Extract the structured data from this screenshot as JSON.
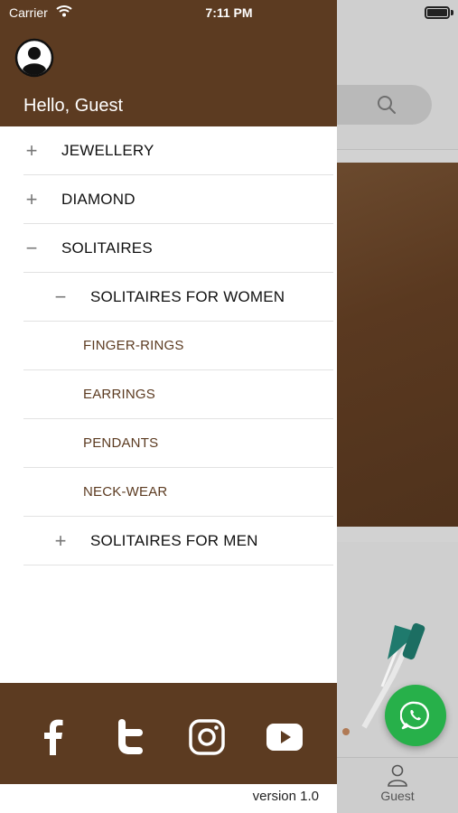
{
  "status_bar": {
    "carrier": "Carrier",
    "time": "7:11 PM"
  },
  "drawer": {
    "greeting": "Hello, Guest",
    "menu": [
      {
        "label": "JEWELLERY",
        "level": 0,
        "toggle": "+"
      },
      {
        "label": "DIAMOND",
        "level": 0,
        "toggle": "+"
      },
      {
        "label": "SOLITAIRES",
        "level": 0,
        "toggle": "−"
      },
      {
        "label": "SOLITAIRES FOR WOMEN",
        "level": 1,
        "toggle": "−"
      },
      {
        "label": "FINGER-RINGS",
        "level": 2
      },
      {
        "label": "EARRINGS",
        "level": 2
      },
      {
        "label": "PENDANTS",
        "level": 2
      },
      {
        "label": "NECK-WEAR",
        "level": 2
      },
      {
        "label": "SOLITAIRES FOR MEN",
        "level": 1,
        "toggle": "+"
      }
    ],
    "social": [
      "facebook-icon",
      "twitter-icon",
      "instagram-icon",
      "youtube-icon"
    ],
    "version": "version 1.0"
  },
  "tabbar": {
    "guest_label": "Guest"
  },
  "colors": {
    "brand_brown": "#5c3b21",
    "whatsapp_green": "#27b04a"
  }
}
